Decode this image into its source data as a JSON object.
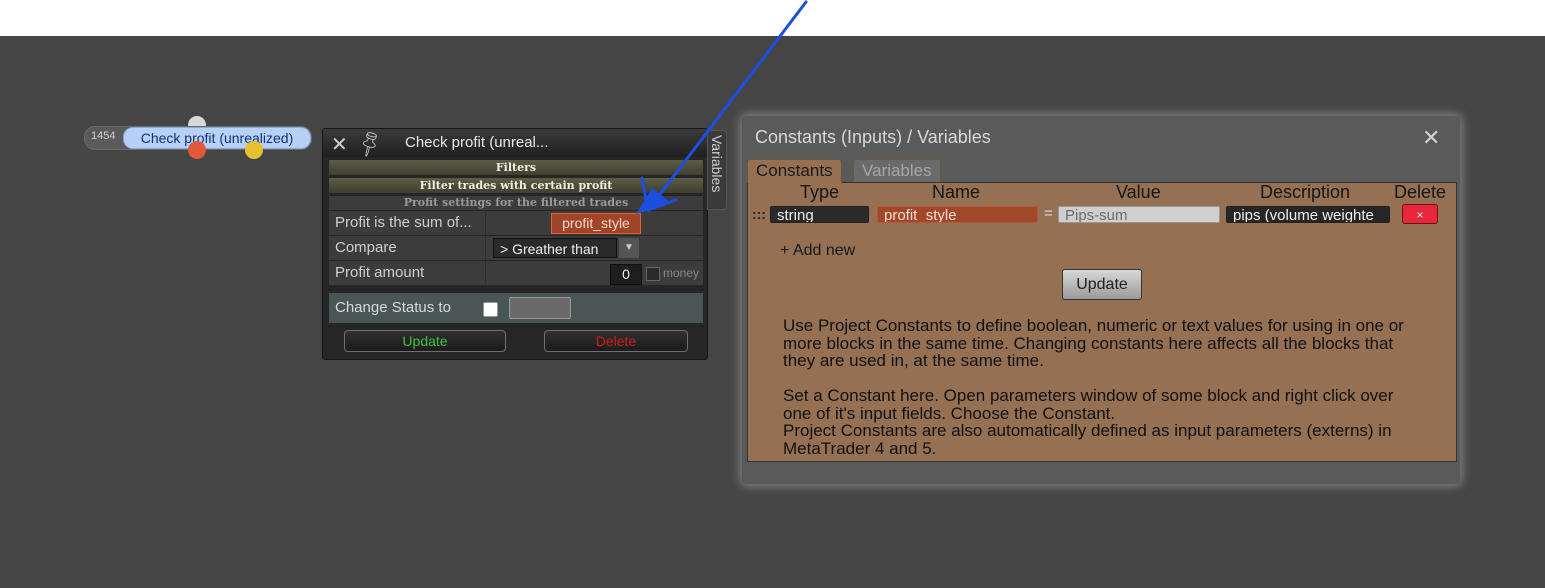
{
  "node": {
    "id": "1454",
    "title": "Check profit (unrealized)"
  },
  "param_window": {
    "title": "Check profit (unreal...",
    "vars_tab": "Variables",
    "section_filters": "Filters",
    "section_filter_trades": "Filter trades with certain profit",
    "section_profit_settings": "Profit settings for the filtered trades",
    "fields": [
      {
        "label": "Profit is the sum of...",
        "value": "profit_style"
      },
      {
        "label": "Compare",
        "value": "> Greather than"
      },
      {
        "label": "Profit amount",
        "value": "0"
      }
    ],
    "money_label": "money",
    "change_status_label": "Change Status to",
    "update_label": "Update",
    "delete_label": "Delete"
  },
  "constants_dialog": {
    "title": "Constants (Inputs) / Variables",
    "tabs": [
      "Constants",
      "Variables"
    ],
    "columns": [
      "Type",
      "Name",
      "Value",
      "Description",
      "Delete"
    ],
    "rows": [
      {
        "type": "string",
        "name": "profit_style",
        "value": "Pips-sum",
        "description": "pips (volume weighte",
        "delete": "×"
      }
    ],
    "drag_handle": ":::",
    "equals": "=",
    "add_new_label": "+ Add new",
    "update_label": "Update",
    "help_paragraph_1": "Use Project Constants to define boolean, numeric or text values for using in one or more blocks in the same time. Changing constants here affects all the blocks that they are used in, at the same time.",
    "help_paragraph_2": "Set a Constant here. Open parameters window of some block and right click over one of it's input fields. Choose the Constant.",
    "help_paragraph_3": "Project Constants are also automatically defined as input parameters (externs) in MetaTrader 4 and 5."
  },
  "icons": {
    "close": "close-icon",
    "pin": "pin-icon",
    "dropdown": "chevron-down-icon"
  },
  "colors": {
    "workspace_bg": "#454545",
    "constant_field": "#a3472b",
    "dialog_body": "#957053",
    "update_green": "#41c23b",
    "delete_red": "#d21b1b",
    "annotation_arrow": "#1a4fe0"
  }
}
